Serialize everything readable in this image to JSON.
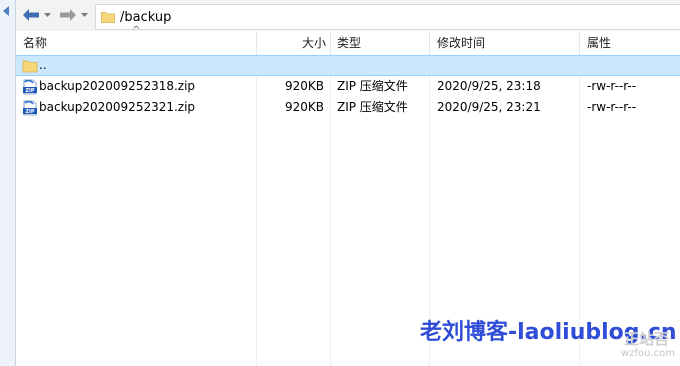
{
  "address": {
    "path": "/backup"
  },
  "columns": {
    "name": "名称",
    "size": "大小",
    "type": "类型",
    "modified": "修改时间",
    "attributes": "属性"
  },
  "rows": [
    {
      "name": "..",
      "size": "",
      "type": "",
      "modified": "",
      "attributes": "",
      "icon": "folder-icon",
      "selected": true
    },
    {
      "name": "backup202009252318.zip",
      "size": "920KB",
      "type": "ZIP 压缩文件",
      "modified": "2020/9/25, 23:18",
      "attributes": "-rw-r--r--",
      "icon": "zip-file-icon",
      "selected": false
    },
    {
      "name": "backup202009252321.zip",
      "size": "920KB",
      "type": "ZIP 压缩文件",
      "modified": "2020/9/25, 23:21",
      "attributes": "-rw-r--r--",
      "icon": "zip-file-icon",
      "selected": false
    }
  ],
  "watermark": {
    "main": "老刘博客-laoliublog.cn",
    "small_1": "正站否",
    "small_2": "wzfou.com"
  },
  "colors": {
    "selection": "#cce8ff",
    "selection_border": "#99d1ff",
    "watermark": "#2f4dd6"
  }
}
